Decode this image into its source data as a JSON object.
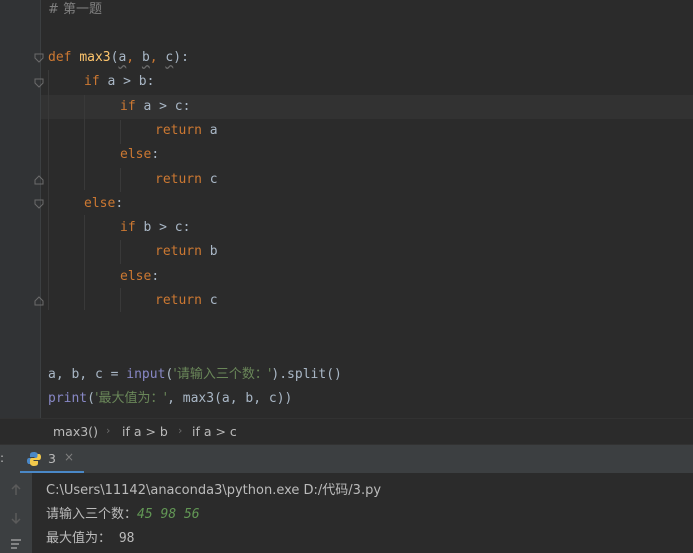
{
  "editor": {
    "lines": [
      {
        "comment": "# 第一题"
      },
      {
        "def_kw": "def",
        "fn_name": "max3",
        "open": "(",
        "p1": "a",
        "c1": ", ",
        "p2": "b",
        "c2": ", ",
        "p3": "c",
        "close": "):"
      },
      {
        "kw": "if",
        "rest": " a > b:"
      },
      {
        "kw": "if",
        "rest": " a > c:"
      },
      {
        "kw": "return",
        "rest": " a"
      },
      {
        "kw": "else",
        "rest": ":"
      },
      {
        "kw": "return",
        "rest": " c"
      },
      {
        "kw": "else",
        "rest": ":"
      },
      {
        "kw": "if",
        "rest": " b > c:"
      },
      {
        "kw": "return",
        "rest": " b"
      },
      {
        "kw": "else",
        "rest": ":"
      },
      {
        "kw": "return",
        "rest": " c"
      },
      {
        "pre": "a, b, c = ",
        "builtin": "input",
        "open": "(",
        "str": "'请输入三个数：'",
        "post": ").split()"
      },
      {
        "builtin": "print",
        "open": "(",
        "str": "'最大值为：'",
        "post": ", max3(a, b, c))"
      }
    ]
  },
  "breadcrumb": {
    "items": [
      "max3()",
      "if a > b",
      "if a > c"
    ]
  },
  "run_panel": {
    "colon": ":",
    "tab_label": "3",
    "tab_close": "×",
    "output": {
      "command": "C:\\Users\\11142\\anaconda3\\python.exe D:/代码/3.py",
      "prompt": "请输入三个数：",
      "input_value": "45 98 56",
      "result_label": "最大值为：",
      "result_value": " 98"
    }
  },
  "colors": {
    "keyword": "#cc7832",
    "function": "#ffc66d",
    "string": "#6a8759",
    "accent": "#4a88c7"
  }
}
